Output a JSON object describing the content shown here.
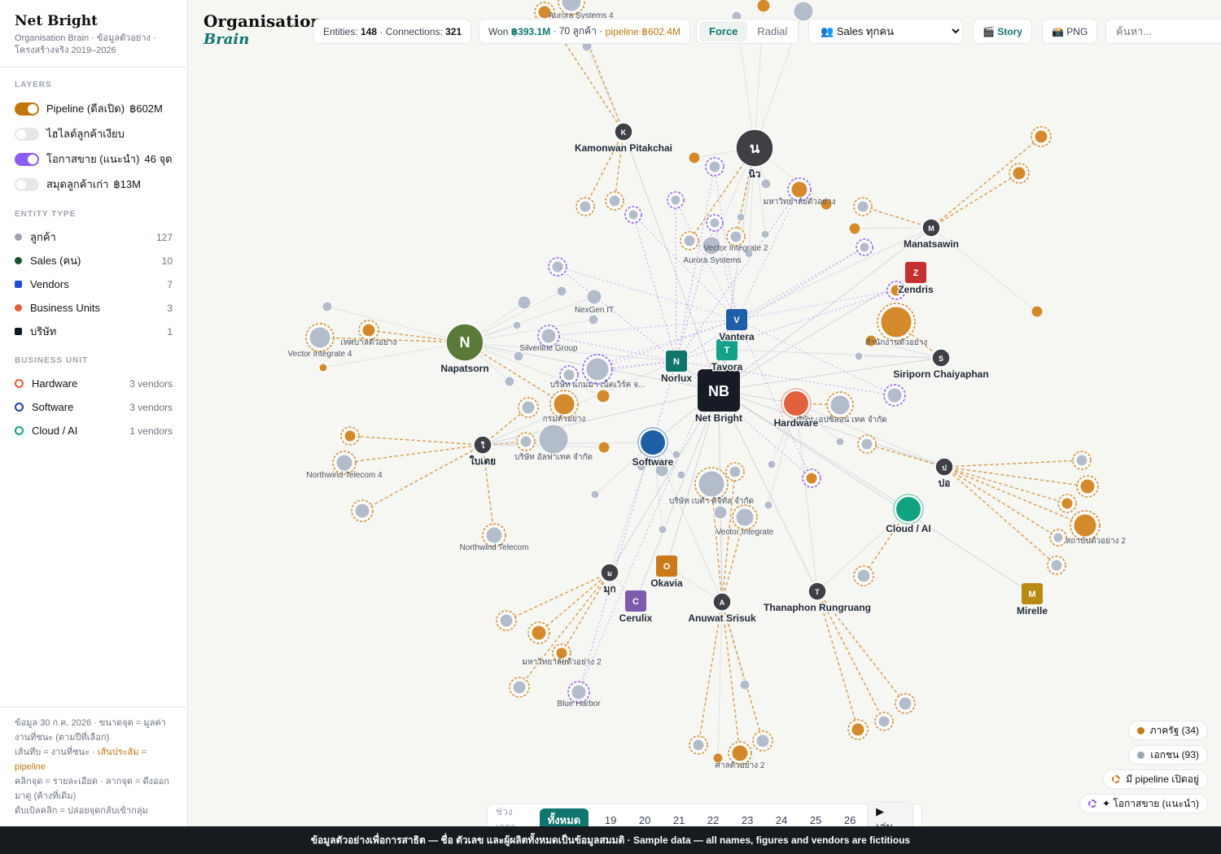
{
  "brand": {
    "name": "Net Bright",
    "subtitle": "Organisation Brain · ข้อมูลตัวอย่าง · โครงสร้างจริง 2019–2026"
  },
  "layers_title": "LAYERS",
  "layers": [
    {
      "label": "Pipeline (ดีลเปิด)",
      "count": "฿602M",
      "on": true,
      "color": "#c2750b"
    },
    {
      "label": "ไฮไลต์ลูกค้าเงียบ",
      "count": "",
      "on": false,
      "color": "#e5e7eb"
    },
    {
      "label": "โอกาสขาย (แนะนำ)",
      "count": "46 จุด",
      "on": true,
      "color": "#8b5cf6"
    },
    {
      "label": "สมุดลูกค้าเก่า",
      "count": "฿13M",
      "on": false,
      "color": "#e5e7eb"
    }
  ],
  "entity_title": "ENTITY TYPE",
  "entity_types": [
    {
      "label": "ลูกค้า",
      "count": "127",
      "color": "#9ca3af",
      "shape": "dot"
    },
    {
      "label": "Sales (คน)",
      "count": "10",
      "color": "#14532d",
      "shape": "dot"
    },
    {
      "label": "Vendors",
      "count": "7",
      "color": "#1d4ed8",
      "shape": "sq"
    },
    {
      "label": "Business Units",
      "count": "3",
      "color": "#e2603b",
      "shape": "dot"
    },
    {
      "label": "บริษัท",
      "count": "1",
      "color": "#111827",
      "shape": "sq"
    }
  ],
  "bu_title": "BUSINESS UNIT",
  "business_units": [
    {
      "label": "Hardware",
      "count": "3 vendors",
      "color": "#e2603b"
    },
    {
      "label": "Software",
      "count": "3 vendors",
      "color": "#1e40af"
    },
    {
      "label": "Cloud / AI",
      "count": "1 vendors",
      "color": "#10a37f"
    }
  ],
  "footer": {
    "line1": "ข้อมูล 30 ก.ค. 2026 · ขนาดจุด = มูลค่างานที่ชนะ (ตามปีที่เลือก)",
    "line2a": "เส้นทึบ = งานที่ชนะ · ",
    "line2b": "เส้นประส้ม = pipeline",
    "line3": "คลิกจุด = รายละเอียด · ลากจุด = ดึงออกมาดู (ค้างที่เดิม)",
    "line4": "ดับเบิลคลิก = ปล่อยจุดกลับเข้ากลุ่ม"
  },
  "header": {
    "title_a": "Organisation",
    "title_b": "Brain",
    "entities_label": "Entities:",
    "entities": "148",
    "connections_label": "· Connections:",
    "connections": "321",
    "won_label": "Won",
    "won": "฿393.1M",
    "won_customers": "· 70 ลูกค้า ·",
    "pipeline": "pipeline ฿602.4M",
    "mode_force": "Force",
    "mode_radial": "Radial",
    "sales_select": "👥 Sales ทุกคน",
    "story": "🎬 Story",
    "png": "📸 PNG",
    "search_placeholder": "ค้นหา..."
  },
  "timeline": {
    "label": "ช่วงเวลา",
    "all": "ทั้งหมด",
    "years": [
      "19",
      "20",
      "21",
      "22",
      "23",
      "24",
      "25",
      "26"
    ],
    "play": "▶ เล่น"
  },
  "chips": [
    {
      "label": "ภาครัฐ (34)",
      "kind": "gov"
    },
    {
      "label": "เอกชน (93)",
      "kind": "private"
    },
    {
      "label": "มี pipeline เปิดอยู่",
      "kind": "pipe"
    },
    {
      "label": "✦ โอกาสขาย (แนะนำ)",
      "kind": "opp"
    }
  ],
  "banner": "ข้อมูลตัวอย่างเพื่อการสาธิต — ชื่อ ตัวเลข และผู้ผลิตทั้งหมดเป็นข้อมูลสมมติ · Sample data — all names, figures and vendors are fictitious",
  "graph": {
    "center": {
      "id": "nb",
      "initials": "NB",
      "label": "Net Bright"
    },
    "bus": [
      {
        "id": "hw",
        "label": "Hardware",
        "color": "#e2603b"
      },
      {
        "id": "sw",
        "label": "Software",
        "color": "#1e5fa8"
      },
      {
        "id": "cl",
        "label": "Cloud / AI",
        "color": "#10a37f"
      }
    ],
    "vendors": [
      {
        "id": "v",
        "letter": "V",
        "label": "Vantera",
        "color": "#1e5fa8"
      },
      {
        "id": "t",
        "letter": "T",
        "label": "Tavora",
        "color": "#14a089"
      },
      {
        "id": "n",
        "letter": "N",
        "label": "Norlux",
        "color": "#0f766e"
      },
      {
        "id": "z",
        "letter": "Z",
        "label": "Zendris",
        "color": "#c53030"
      },
      {
        "id": "o",
        "letter": "O",
        "label": "Okavia",
        "color": "#c97a1a"
      },
      {
        "id": "c",
        "letter": "C",
        "label": "Cerulix",
        "color": "#7c5cad"
      },
      {
        "id": "m",
        "letter": "M",
        "label": "Mirelle",
        "color": "#b88a0f"
      }
    ],
    "sales": [
      {
        "id": "nw",
        "letter": "น",
        "label": "นิว",
        "big": true
      },
      {
        "id": "np",
        "letter": "N",
        "label": "Napatsorn",
        "big": true,
        "color": "#5b7a3a"
      },
      {
        "id": "kp",
        "letter": "K",
        "label": "Kamonwan Pitakchai"
      },
      {
        "id": "mn",
        "letter": "M",
        "label": "Manatsawin"
      },
      {
        "id": "sc",
        "letter": "S",
        "label": "Siriporn Chaiyaphan"
      },
      {
        "id": "bt",
        "letter": "ใ",
        "label": "ใบเตย"
      },
      {
        "id": "po",
        "letter": "ป",
        "label": "ปอ"
      },
      {
        "id": "mk",
        "letter": "ม",
        "label": "มุก"
      },
      {
        "id": "as",
        "letter": "A",
        "label": "Anuwat Srisuk"
      },
      {
        "id": "tr",
        "letter": "T",
        "label": "Thanaphon Rungruang"
      }
    ],
    "customer_labels": [
      "Aurora Systems 4",
      "Vector Integrate 2",
      "Aurora Systems",
      "มหาวิทยาลัยตัวอย่าง",
      "NexGen IT",
      "Silverline Group",
      "Vector Integrate 4",
      "เทศบาลตัวอย่าง",
      "บริษัท แกมมา เน็ตเวิร์ค จ...",
      "กรมตัวอย่าง",
      "บริษัท อัลฟาเทค จำกัด",
      "Northwind Telecom 4",
      "Northwind Telecom",
      "สำนักงานตัวอย่าง",
      "บริษัท เอปซิลอน เทค จำกัด",
      "บริษัท เบต้า ดิจิทัล จำกัด",
      "Vector Integrate",
      "สถาบันตัวอย่าง 2",
      "มหาวิทยาลัยตัวอย่าง 2",
      "Blue Harbor",
      "ศาลตัวอย่าง 2"
    ]
  }
}
